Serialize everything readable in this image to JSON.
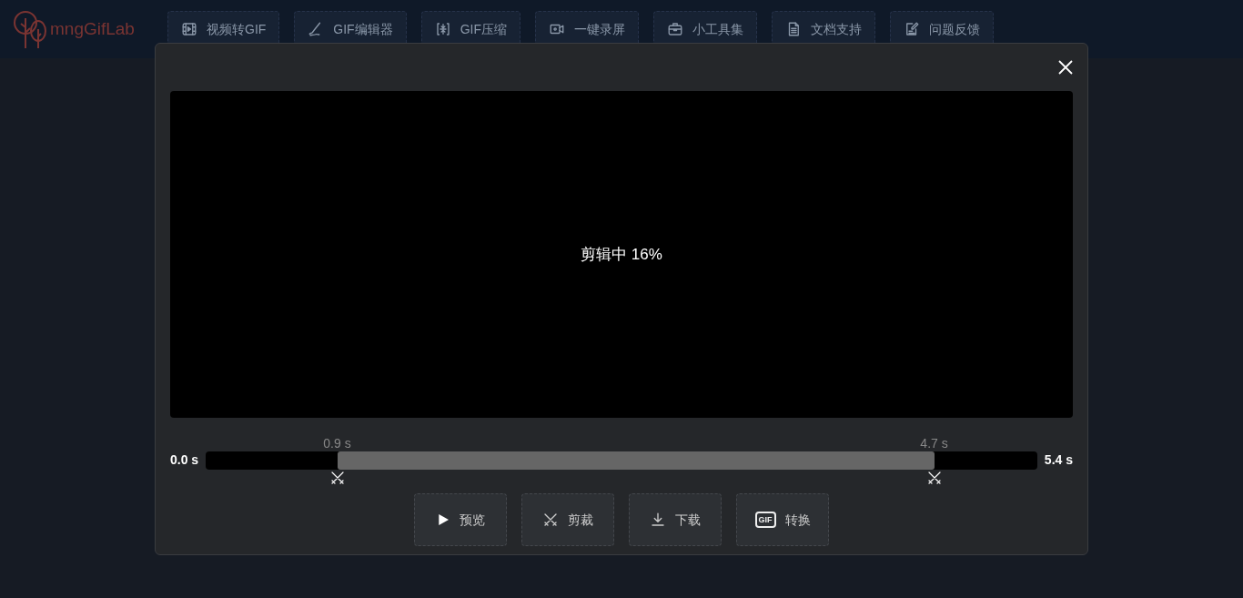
{
  "logo": {
    "text": "mngGifLab"
  },
  "nav": [
    {
      "label": "视频转GIF",
      "kind": "film"
    },
    {
      "label": "GIF编辑器",
      "kind": "brush"
    },
    {
      "label": "GIF压缩",
      "kind": "compress"
    },
    {
      "label": "一键录屏",
      "kind": "camera"
    },
    {
      "label": "小工具集",
      "kind": "toolbox"
    },
    {
      "label": "文档支持",
      "kind": "doc"
    },
    {
      "label": "问题反馈",
      "kind": "edit"
    }
  ],
  "dialog": {
    "status": "剪辑中 16%",
    "timeline": {
      "start": "0.0 s",
      "end": "5.4 s",
      "handles": [
        {
          "label": "0.9 s",
          "level": 0.158
        },
        {
          "label": "4.7 s",
          "level": 0.876
        }
      ]
    },
    "buttons": [
      {
        "label": "预览",
        "kind": "play"
      },
      {
        "label": "剪裁",
        "kind": "scissors"
      },
      {
        "label": "下载",
        "kind": "download"
      },
      {
        "label": "转换",
        "kind": "gif",
        "icon_label": "GIF"
      }
    ]
  }
}
